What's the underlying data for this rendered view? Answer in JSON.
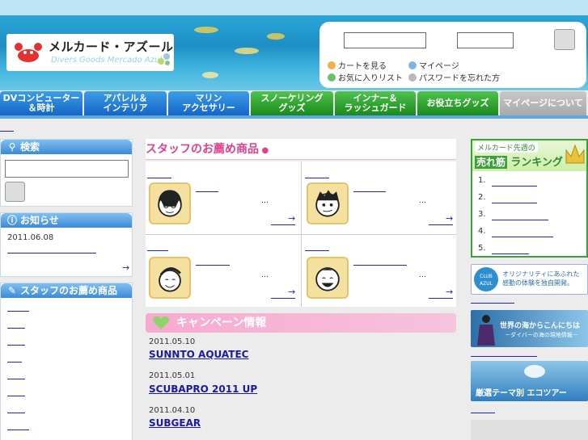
{
  "header": {
    "logo_jp": "メルカード・アズール",
    "logo_en": "Divers Goods Mercado Azul",
    "login": {
      "links": [
        {
          "label": "カートを見る",
          "color": "#f2b04a"
        },
        {
          "label": "マイページ",
          "color": "#7fb4e6"
        },
        {
          "label": "お気に入りリスト",
          "color": "#6cc06c"
        },
        {
          "label": "パスワードを忘れた方",
          "color": "#b9b9b9"
        }
      ]
    }
  },
  "nav": [
    {
      "label": "DVコンピューター\n＆時計",
      "style": "blue"
    },
    {
      "label": "アパレル＆\nインテリア",
      "style": "blue"
    },
    {
      "label": "マリン\nアクセサリー",
      "style": "blue"
    },
    {
      "label": "スノーケリング\nグッズ",
      "style": "green"
    },
    {
      "label": "インナー＆\nラッシュガード",
      "style": "green"
    },
    {
      "label": "お役立ちグッズ",
      "style": "green"
    },
    {
      "label": "マイページについて",
      "style": "gray"
    }
  ],
  "sidebar": {
    "search_title": "検索",
    "notice_title": "お知らせ",
    "notice_date": "2011.06.08",
    "staff_title": "スタッフのお薦め商品",
    "arrow": "→"
  },
  "main": {
    "section_title": "スタッフのお薦め商品",
    "ellipsis": "…",
    "arrow": "→",
    "campaign_title": "キャンペーン情報",
    "news": [
      {
        "date": "2011.05.10",
        "title": "SUNNTO AQUATEC"
      },
      {
        "date": "2011.05.01",
        "title": "SCUBAPRO 2011 UP"
      },
      {
        "date": "2011.04.10",
        "title": "SUBGEAR"
      }
    ]
  },
  "right": {
    "ranking_small": "メルカード先週の",
    "ranking_label1": "売れ筋",
    "ranking_label2": "ランキング",
    "ranks": [
      "1.",
      "2.",
      "3.",
      "4.",
      "5."
    ],
    "banner1_text": "オリジナリティにあふれた\n感動の体験を独自開発。",
    "banner1_badge": "CLUB AZUL",
    "banner2_text": "世界の海からこんにちは",
    "banner2_sub": "－ダイバーの海の現地情報－",
    "banner3_text": "厳選テーマ別 エコツアー"
  }
}
